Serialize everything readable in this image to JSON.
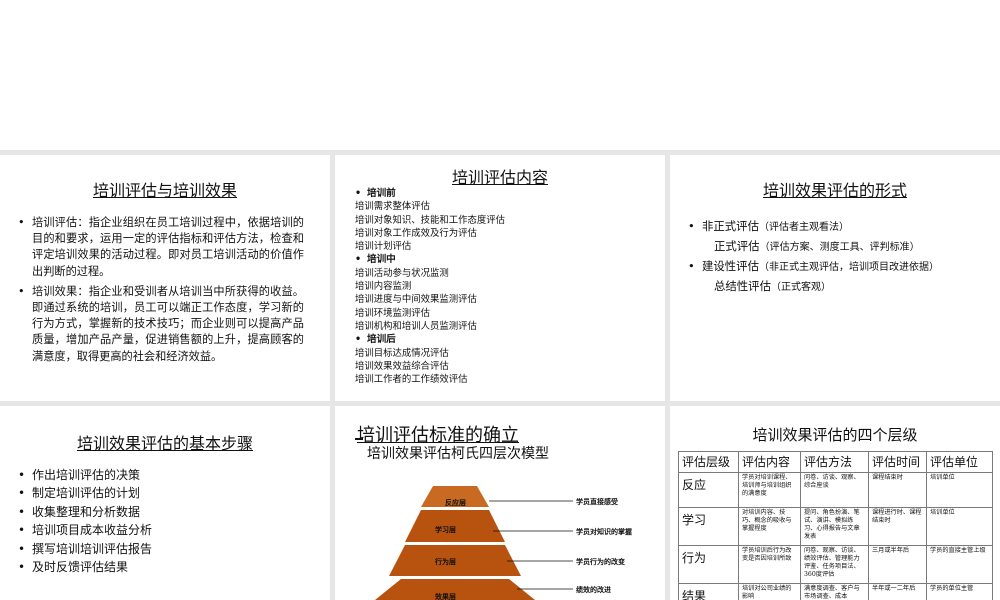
{
  "slide1": {
    "title": "培训评估与培训效果",
    "bullets": [
      "培训评估：指企业组织在员工培训过程中，依据培训的目的和要求，运用一定的评估指标和评估方法，检查和评定培训效果的活动过程。即对员工培训活动的价值作出判断的过程。",
      "培训效果：指企业和受训者从培训当中所获得的收益。即通过系统的培训，员工可以端正工作态度，学习新的行为方式，掌握新的技术技巧；而企业则可以提高产品质量，增加产品产量，促进销售额的上升，提高顾客的满意度，取得更高的社会和经济效益。"
    ]
  },
  "slide2": {
    "title": "培训评估内容",
    "sections": [
      {
        "heading": "培训前",
        "items": [
          "培训需求整体评估",
          "培训对象知识、技能和工作态度评估",
          "培训对象工作成效及行为评估",
          "培训计划评估"
        ]
      },
      {
        "heading": "培训中",
        "items": [
          "培训活动参与状况监测",
          "培训内容监测",
          "培训进度与中间效果监测评估",
          "培训环境监测评估",
          "培训机构和培训人员监测评估"
        ]
      },
      {
        "heading": "培训后",
        "items": [
          "培训目标达成情况评估",
          "培训效果效益综合评估",
          "培训工作者的工作绩效评估"
        ]
      }
    ]
  },
  "slide3": {
    "title": "培训效果评估的形式",
    "row1": {
      "main": "非正式评估",
      "note": "（评估者主观看法）"
    },
    "row2": {
      "main": "正式评估",
      "note": "（评估方案、测度工具、评判标准）"
    },
    "row3": {
      "main": "建设性评估",
      "note": "（非正式主观评估，培训项目改进依据）"
    },
    "row4": {
      "main": "总结性评估",
      "note": "（正式客观）"
    }
  },
  "slide4": {
    "title": "培训效果评估的基本步骤",
    "steps": [
      "作出培训评估的决策",
      "制定培训评估的计划",
      "收集整理和分析数据",
      "培训项目成本收益分析",
      "撰写培训培训评估报告",
      "及时反馈评估结果"
    ]
  },
  "slide5": {
    "title": "培训评估标准的确立",
    "subtitle": "培训效果评估柯氏四层次模型",
    "layers": [
      "反应层",
      "学习层",
      "行为层",
      "效果层"
    ],
    "annotations": [
      "学员直接感受",
      "学员对知识的掌握",
      "学员行为的改变",
      "绩效的改进"
    ],
    "colors": {
      "pyramid": "#b8520f",
      "pyramid_light": "#c86a22",
      "text": "#111111"
    }
  },
  "slide6": {
    "title": "培训效果评估的四个层级",
    "headers": [
      "评估层级",
      "评估内容",
      "评估方法",
      "评估时间",
      "评估单位"
    ],
    "rows": [
      [
        "反应",
        "学员对培训课程、培训师与培训组织的满意度",
        "问卷、访谈、观察、综合座谈",
        "课程结束时",
        "培训单位"
      ],
      [
        "学习",
        "对培训内容、技巧、概念的吸收与掌握程度",
        "提问、角色扮演、笔试、演讲、模拟练习、心得报告与文章发表",
        "课程进行时、课程结束时",
        "培训单位"
      ],
      [
        "行为",
        "学员培训后行为改变是否因培训所致",
        "问卷、观察、访谈、绩效评估、管理能力评鉴、任务项目法、360度评估",
        "三月或半年后",
        "学员的直接主管上级"
      ],
      [
        "结果",
        "培训对公司业绩的影响",
        "满意度调查、客户与市场调查、成本",
        "半年或一二年后",
        "学员的单位主管"
      ]
    ]
  }
}
